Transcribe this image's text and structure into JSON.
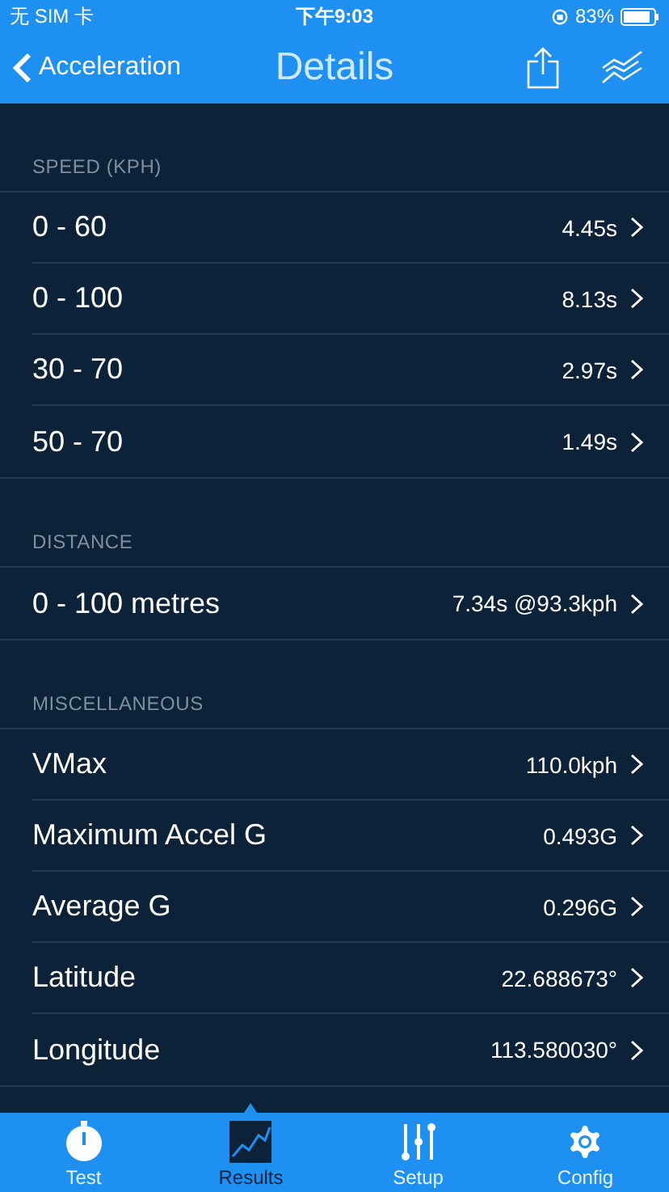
{
  "status_bar": {
    "carrier": "无 SIM 卡",
    "time": "下午9:03",
    "battery": "83%"
  },
  "nav": {
    "back": "Acceleration",
    "title": "Details"
  },
  "sections": [
    {
      "title": "SPEED (KPH)",
      "rows": [
        {
          "label": "0 - 60",
          "value": "4.45s"
        },
        {
          "label": "0 - 100",
          "value": "8.13s"
        },
        {
          "label": "30 - 70",
          "value": "2.97s"
        },
        {
          "label": "50 - 70",
          "value": "1.49s"
        }
      ]
    },
    {
      "title": "DISTANCE",
      "rows": [
        {
          "label": "0 - 100 metres",
          "value": "7.34s @93.3kph"
        }
      ]
    },
    {
      "title": "MISCELLANEOUS",
      "rows": [
        {
          "label": "VMax",
          "value": "110.0kph"
        },
        {
          "label": "Maximum Accel G",
          "value": "0.493G"
        },
        {
          "label": "Average G",
          "value": "0.296G"
        },
        {
          "label": "Latitude",
          "value": "22.688673°"
        },
        {
          "label": "Longitude",
          "value": "113.580030°"
        }
      ]
    }
  ],
  "tabs": [
    {
      "kind": "stopwatch",
      "label": "Test",
      "selected": false
    },
    {
      "kind": "chart",
      "label": "Results",
      "selected": true
    },
    {
      "kind": "sliders",
      "label": "Setup",
      "selected": false
    },
    {
      "kind": "gear",
      "label": "Config",
      "selected": false
    }
  ]
}
